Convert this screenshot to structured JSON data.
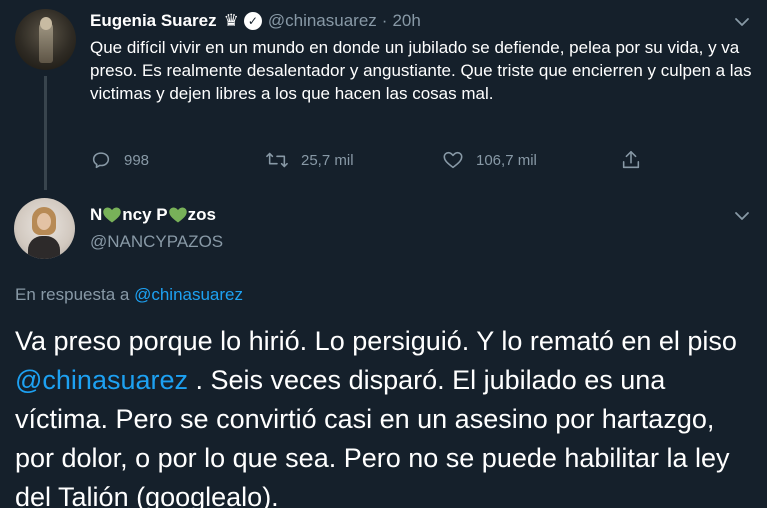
{
  "tweet": {
    "author_name": "Eugenia Suarez",
    "crown_icon": "crown-icon",
    "verified_icon": "verified-badge-icon",
    "handle": "@chinasuarez",
    "separator": "·",
    "time": "20h",
    "text": "Que difícil vivir en un mundo en donde un jubilado se defiende, pelea por su vida, y va preso. Es realmente desalentador y angustiante. Que triste que encierren y culpen a las victimas y dejen libres a los que hacen las cosas mal.",
    "stats": {
      "replies": "998",
      "retweets": "25,7 mil",
      "likes": "106,7 mil"
    }
  },
  "reply": {
    "name_part1": "N",
    "name_part2": "ncy P",
    "name_part3": "zos",
    "name_emoji": "green-heart-icon",
    "handle": "@NANCYPAZOS",
    "reply_to_prefix": "En respuesta a ",
    "reply_to_handle": "@chinasuarez",
    "text_before": "Va preso porque lo hirió. Lo persiguió. Y lo remató en el piso ",
    "text_mention": "@chinasuarez",
    "text_after": " . Seis veces disparó. El jubilado es una víctima. Pero se convirtió casi en un asesino por hartazgo, por dolor,  o por lo que sea. Pero no se puede habilitar la ley del Talión (googlealo)."
  },
  "colors": {
    "background": "#15202b",
    "secondary_text": "#8899a6",
    "link": "#1da1f2",
    "heart_green": "#78b159"
  }
}
